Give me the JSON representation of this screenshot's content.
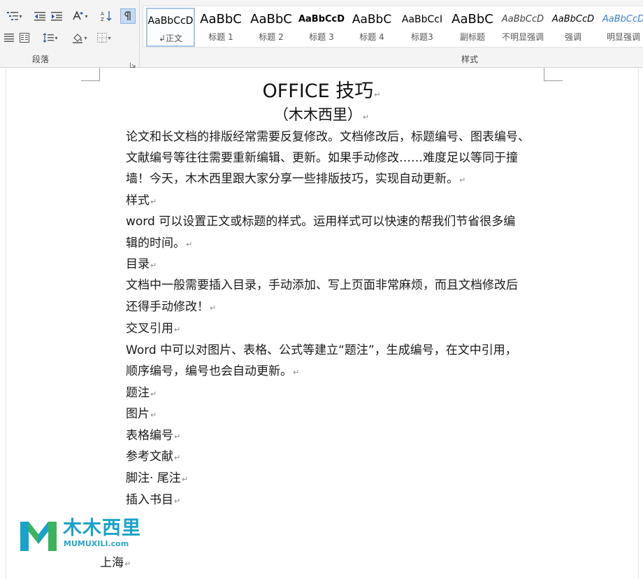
{
  "ribbon": {
    "paragraph_group": {
      "label": "段落",
      "tools": [
        {
          "name": "multilevel-list",
          "icon": "multilevel-list-icon"
        },
        {
          "name": "decrease-indent",
          "icon": "decrease-indent-icon"
        },
        {
          "name": "increase-indent",
          "icon": "increase-indent-icon"
        },
        {
          "name": "chinese-layout",
          "icon": "chinese-layout-icon"
        },
        {
          "name": "sort",
          "icon": "sort-icon"
        },
        {
          "name": "show-marks",
          "icon": "paragraph-mark-icon",
          "active": true
        },
        {
          "name": "align-distributed",
          "icon": "align-distributed-icon"
        },
        {
          "name": "column-layout",
          "icon": "columns-icon"
        },
        {
          "name": "line-spacing",
          "icon": "line-spacing-icon"
        },
        {
          "name": "shading",
          "icon": "shading-icon"
        },
        {
          "name": "borders",
          "icon": "borders-icon"
        }
      ]
    },
    "styles_group": {
      "label": "样式",
      "styles": [
        {
          "preview": "AaBbCcD",
          "name": "↲正文",
          "selected": true
        },
        {
          "preview": "AaBbC",
          "name": "标题 1"
        },
        {
          "preview": "AaBbC",
          "name": "标题 2"
        },
        {
          "preview": "AaBbCcD",
          "name": "标题 3"
        },
        {
          "preview": "AaBbC",
          "name": "标题 4"
        },
        {
          "preview": "AaBbCcI",
          "name": "标题3"
        },
        {
          "preview": "AaBbC",
          "name": "副标题"
        },
        {
          "preview": "AaBbCcD",
          "name": "不明显强调"
        },
        {
          "preview": "AaBbCcD",
          "name": "强调"
        },
        {
          "preview": "AaBbCcD",
          "name": "明显强调"
        }
      ]
    }
  },
  "document": {
    "title": "OFFICE 技巧",
    "subtitle": "（木木西里）",
    "paragraph_mark": "↵",
    "lines": [
      "论文和长文档的排版经常需要反复修改。文档修改后，标题编号、图表编号、",
      "文献编号等往往需要重新编辑、更新。如果手动修改……难度足以等同于撞",
      "墙！今天，木木西里跟大家分享一些排版技巧，实现自动更新。",
      "样式",
      "word 可以设置正文或标题的样式。运用样式可以快速的帮我们节省很多编",
      "辑的时间。",
      "目录",
      "文档中一般需要插入目录，手动添加、写上页面非常麻烦，而且文档修改后",
      "还得手动修改！",
      "交叉引用",
      "Word 中可以对图片、表格、公式等建立“题注”，生成编号，在文中引用，",
      "顺序编号，编号也会自动更新。",
      "题注",
      "图片",
      "表格编号",
      "参考文献",
      "脚注· 尾注",
      "插入书目",
      "",
      "上海"
    ],
    "line_has_mark": [
      false,
      false,
      true,
      true,
      false,
      true,
      true,
      false,
      true,
      true,
      false,
      true,
      true,
      true,
      true,
      true,
      true,
      true,
      true,
      true
    ]
  },
  "watermark": {
    "name_cn": "木木西里",
    "url": "MUMUXILI.com"
  },
  "colors": {
    "ribbon_bg": "#f4f4f4",
    "selected_style_border": "#a9c6ea",
    "logo_blue": "#1aa3c8",
    "logo_green": "#3cb35a"
  }
}
